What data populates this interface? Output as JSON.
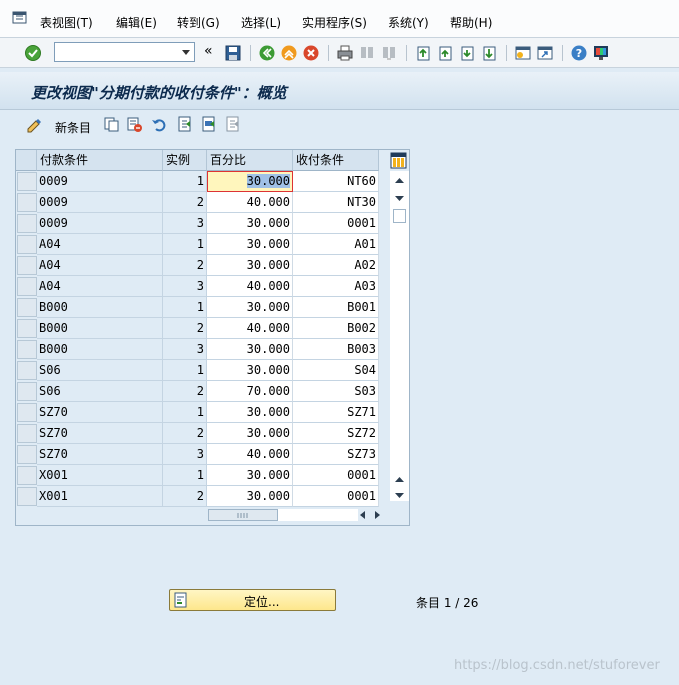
{
  "menubar": {
    "items": [
      "表视图(T)",
      "编辑(E)",
      "转到(G)",
      "选择(L)",
      "实用程序(S)",
      "系统(Y)",
      "帮助(H)"
    ]
  },
  "toolbar": {
    "command_value": "",
    "double_arrow": "«"
  },
  "title": "更改视图\"分期付款的收付条件\"：概览",
  "app_toolbar": {
    "new_entries_label": "新条目"
  },
  "table": {
    "columns": [
      "付款条件",
      "实例",
      "百分比",
      "收付条件"
    ],
    "rows": [
      [
        "0009",
        "1",
        "30.000",
        "NT60"
      ],
      [
        "0009",
        "2",
        "40.000",
        "NT30"
      ],
      [
        "0009",
        "3",
        "30.000",
        "0001"
      ],
      [
        "A04",
        "1",
        "30.000",
        "A01"
      ],
      [
        "A04",
        "2",
        "30.000",
        "A02"
      ],
      [
        "A04",
        "3",
        "40.000",
        "A03"
      ],
      [
        "B000",
        "1",
        "30.000",
        "B001"
      ],
      [
        "B000",
        "2",
        "40.000",
        "B002"
      ],
      [
        "B000",
        "3",
        "30.000",
        "B003"
      ],
      [
        "S06",
        "1",
        "30.000",
        "S04"
      ],
      [
        "S06",
        "2",
        "70.000",
        "S03"
      ],
      [
        "SZ70",
        "1",
        "30.000",
        "SZ71"
      ],
      [
        "SZ70",
        "2",
        "30.000",
        "SZ72"
      ],
      [
        "SZ70",
        "3",
        "40.000",
        "SZ73"
      ],
      [
        "X001",
        "1",
        "30.000",
        "0001"
      ],
      [
        "X001",
        "2",
        "30.000",
        "0001"
      ]
    ]
  },
  "position_button_label": "定位...",
  "entry_counter": "条目 1 / 26",
  "watermark": "https://blog.csdn.net/stuforever",
  "colors": {
    "background": "#dfebf5",
    "focus_cell": "#fff6bd",
    "position_button": "#fde78c"
  }
}
